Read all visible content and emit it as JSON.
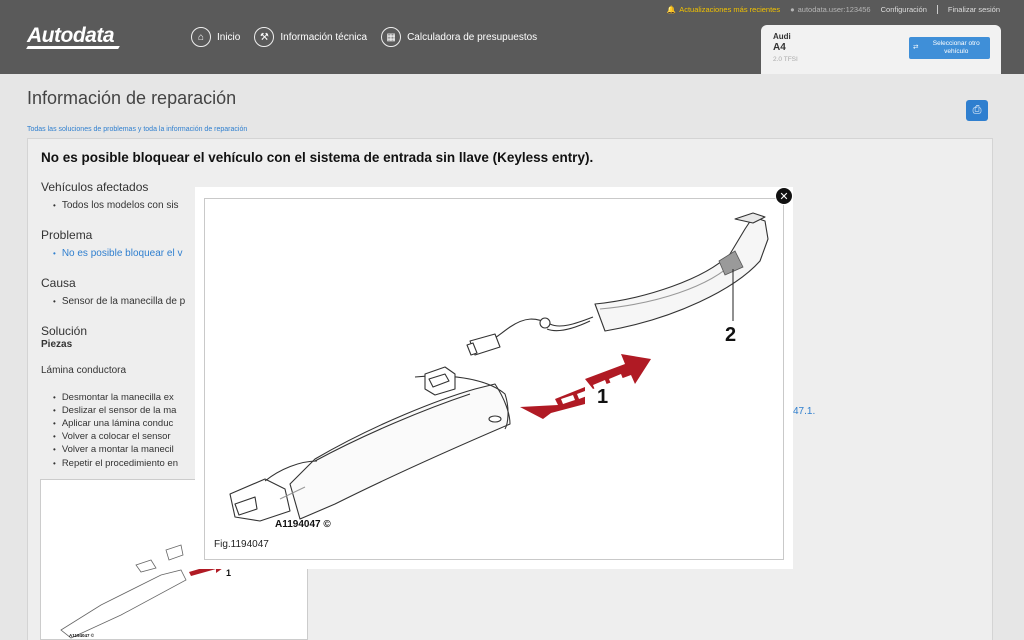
{
  "header": {
    "logo": "Autodata",
    "top": {
      "updates": "Actualizaciones más recientes",
      "user": "autodata.user:123456",
      "config": "Configuración",
      "logout": "Finalizar sesión"
    },
    "nav": [
      {
        "label": "Inicio",
        "icon": "home-icon"
      },
      {
        "label": "Información técnica",
        "icon": "wrench-icon"
      },
      {
        "label": "Calculadora de presupuestos",
        "icon": "calculator-icon"
      }
    ],
    "vehicle": {
      "make": "Audi",
      "model": "A4",
      "engine": "2.0 TFSI",
      "select_label": "Seleccionar otro vehículo"
    }
  },
  "page": {
    "title": "Información de reparación",
    "breadcrumb": "Todas las soluciones de problemas y toda la información de reparación",
    "article_title": "No es posible bloquear el vehículo con el sistema de entrada sin llave (Keyless entry).",
    "sections": {
      "affected_h": "Vehículos afectados",
      "affected_item": "Todos los modelos con sis",
      "problem_h": "Problema",
      "problem_item": "No es posible bloquear el v",
      "cause_h": "Causa",
      "cause_item": "Sensor de la manecilla de p",
      "solution_h": "Solución",
      "parts_h": "Piezas",
      "foil": "Lámina conductora",
      "steps": [
        "Desmontar la manecilla ex",
        "Deslizar el sensor de la ma",
        "Aplicar una lámina conduc",
        "Volver a colocar el sensor",
        "Volver a montar la manecil",
        "Repetir el procedimiento en"
      ],
      "right_link": "47.1.",
      "thumb_code": "A1194047 ©",
      "thumb_callout": "1"
    }
  },
  "modal": {
    "figure_code": "A1194047 ©",
    "caption": "Fig.1194047",
    "callout_1": "1",
    "callout_2": "2",
    "close_icon": "close-icon"
  },
  "colors": {
    "header_bg": "#5a5a5a",
    "accent_blue": "#2f7fcf",
    "arrow_red": "#b01a24",
    "updates_yellow": "#f2c200"
  }
}
